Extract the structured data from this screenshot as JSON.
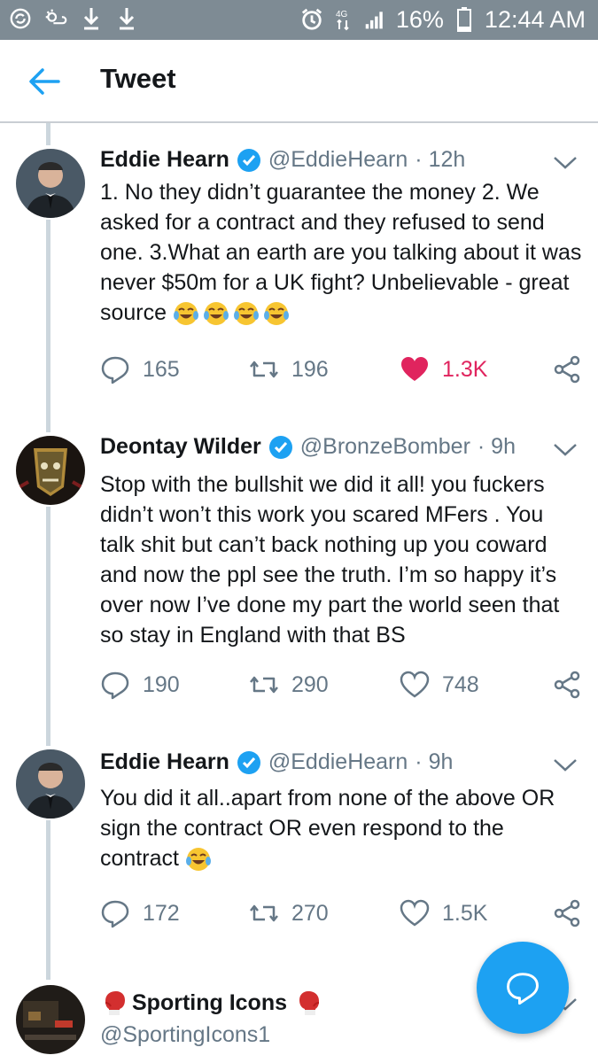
{
  "status_bar": {
    "battery": "16%",
    "time": "12:44 AM"
  },
  "header": {
    "title": "Tweet"
  },
  "tweets": [
    {
      "name": "Eddie Hearn",
      "handle": "@EddieHearn",
      "time": "· 12h",
      "text": "1. No they didn’t guarantee the money 2. We asked for a contract and they refused to send one. 3.What an earth are you talking about it was never $50m for a UK fight? Unbelievable - great source",
      "replies": "165",
      "retweets": "196",
      "likes": "1.3K",
      "liked": true
    },
    {
      "name": "Deontay Wilder",
      "handle": "@BronzeBomber",
      "time": "· 9h",
      "text": "Stop with the bullshit we did it all! you fuckers didn’t won’t this work you scared MFers . You talk shit but can’t back nothing up you coward and now the ppl see the truth. I’m so happy it’s over now I’ve done my part the world seen that so stay in England with that BS",
      "replies": "190",
      "retweets": "290",
      "likes": "748",
      "liked": false
    },
    {
      "name": "Eddie Hearn",
      "handle": "@EddieHearn",
      "time": "· 9h",
      "text": "You did it all..apart from none of the above OR sign the contract OR even respond to the contract",
      "replies": "172",
      "retweets": "270",
      "likes": "1.5K",
      "liked": false
    },
    {
      "name": "Sporting Icons",
      "handle": "@SportingIcons1"
    }
  ],
  "colors": {
    "accent": "#1da1f2",
    "like": "#e0245e",
    "muted": "#657786",
    "status_bar": "#7e8b94"
  }
}
